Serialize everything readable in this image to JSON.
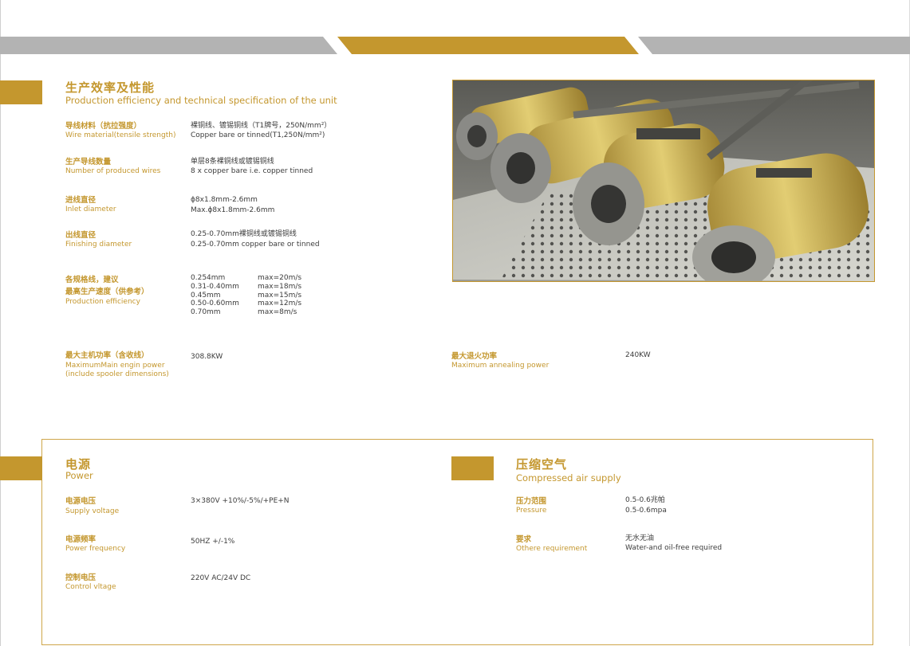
{
  "section_production": {
    "title_zh": "生产效率及性能",
    "title_en": "Production efficiency and technical specification of the unit",
    "specs": [
      {
        "label_zh": "导线材料（抗拉强度）",
        "label_en": "Wire material(tensile strength)",
        "value_1": "裸铜线、镀锡铜线（T1牌号，250N/mm²）",
        "value_2": "Copper bare or  tinned(T1,250N/mm²)"
      },
      {
        "label_zh": "生产导线数量",
        "label_en": "Number of produced wires",
        "value_1": "单层8条裸铜线或镀锡铜线",
        "value_2": "8 x copper bare i.e. copper tinned"
      },
      {
        "label_zh": "进线直径",
        "label_en": "Inlet diameter",
        "value_1": "ɸ8x1.8mm-2.6mm",
        "value_2": "Max.ɸ8x1.8mm-2.6mm"
      },
      {
        "label_zh": "出线直径",
        "label_en": "Finishing diameter",
        "value_1": "0.25-0.70mm裸铜线或镀锡铜线",
        "value_2": "0.25-0.70mm copper bare or tinned"
      }
    ],
    "efficiency": {
      "label_zh_1": "各规格线，建议",
      "label_zh_2": "最高生产速度（供参考）",
      "label_en": "Production efficiency",
      "rows": [
        {
          "diameter": "0.254mm",
          "speed": "max=20m/s"
        },
        {
          "diameter": "0.31-0.40mm",
          "speed": "max=18m/s"
        },
        {
          "diameter": "0.45mm",
          "speed": "max=15m/s"
        },
        {
          "diameter": "0.50-0.60mm",
          "speed": "max=12m/s"
        },
        {
          "diameter": "0.70mm",
          "speed": "max=8m/s"
        }
      ]
    },
    "main_power": {
      "label_zh": "最大主机功率（含收线）",
      "label_en_1": "MaximumMain engin power",
      "label_en_2": "(include spooler dimensions)",
      "value": "308.8KW"
    },
    "annealing_power": {
      "label_zh": "最大退火功率",
      "label_en": "Maximum annealing power",
      "value": "240KW"
    }
  },
  "section_power": {
    "title_zh": "电源",
    "title_en": "Power",
    "specs": [
      {
        "label_zh": "电源电压",
        "label_en": "Supply voltage",
        "value": "3×380V +10%/-5%/+PE+N"
      },
      {
        "label_zh": "电源频率",
        "label_en": "Power frequency",
        "value": "50HZ +/-1%"
      },
      {
        "label_zh": "控制电压",
        "label_en": "Control vltage",
        "value": "220V AC/24V DC"
      }
    ]
  },
  "section_air": {
    "title_zh": "压缩空气",
    "title_en": "Compressed air supply",
    "specs": [
      {
        "label_zh": "压力范围",
        "label_en": "Pressure",
        "value_1": "0.5-0.6兆帕",
        "value_2": "0.5-0.6mpa"
      },
      {
        "label_zh": "要求",
        "label_en": "Othere requirement",
        "value_1": "无水无油",
        "value_2": "Water-and oil-free required"
      }
    ]
  },
  "colors": {
    "accent_gold": "#c4972e",
    "band_gray": "#b3b3b3",
    "text": "#3c3c3c"
  }
}
